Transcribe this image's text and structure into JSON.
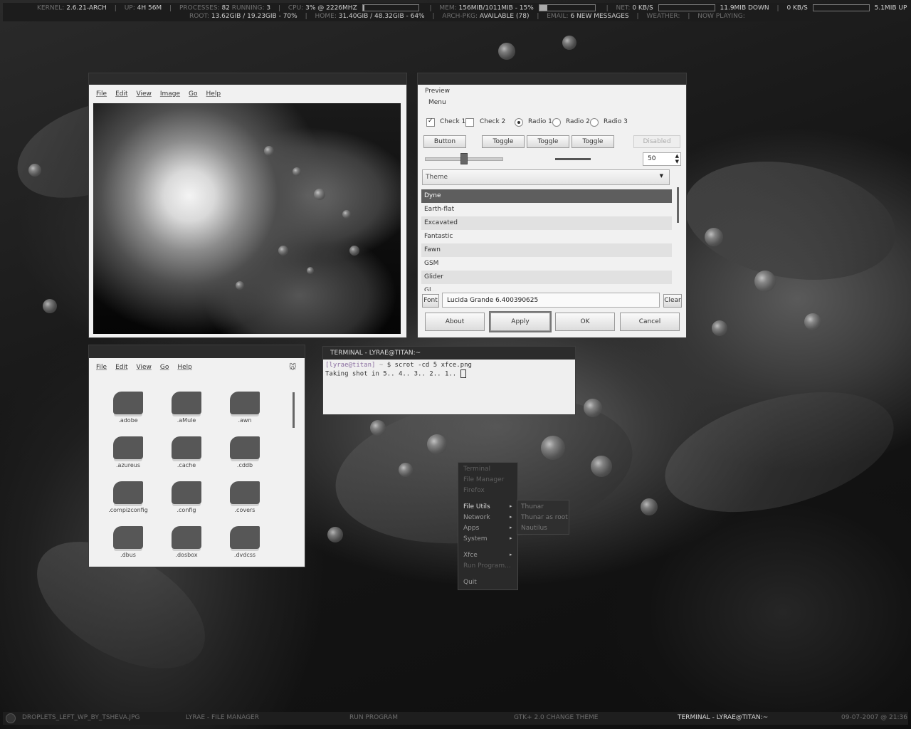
{
  "topbar": {
    "kernel_label": "KERNEL:",
    "kernel": "2.6.21-ARCH",
    "up_label": "UP:",
    "uptime": "4H 56M",
    "processes_label": "PROCESSES:",
    "processes": "82",
    "running_label": "RUNNING:",
    "running": "3",
    "cpu_label": "CPU:",
    "cpu": "3%",
    "cpu_freq": "@ 2226MHZ",
    "cpu_fraction": 0.03,
    "mem_label": "MEM:",
    "mem": "156MIB/1011MIB - 15%",
    "mem_fraction": 0.15,
    "net_label": "NET:",
    "net_down_rate": "0 KB/S",
    "down_total": "11.9MIB DOWN",
    "net_up_rate": "0 KB/S",
    "up_total": "5.1MIB UP",
    "root_label": "ROOT:",
    "root": "13.62GIB / 19.23GIB - 70%",
    "home_label": "HOME:",
    "home": "31.40GIB / 48.32GIB - 64%",
    "archpkg_label": "ARCH-PKG:",
    "archpkg": "AVAILABLE (78)",
    "email_label": "EMAIL:",
    "email": "6 NEW MESSAGES",
    "weather_label": "WEATHER:",
    "nowplaying_label": "NOW PLAYING:"
  },
  "viewer": {
    "menu": [
      "File",
      "Edit",
      "View",
      "Image",
      "Go",
      "Help"
    ]
  },
  "gtk": {
    "preview_label": "Preview",
    "menu_label": "Menu",
    "check1": "Check 1",
    "check2": "Check 2",
    "radio1": "Radio 1",
    "radio2": "Radio 2",
    "radio3": "Radio 3",
    "button": "Button",
    "toggle": "Toggle",
    "disabled": "Disabled",
    "spin_value": "50",
    "slider_level": 0.5,
    "combo_value": "Theme",
    "themes": [
      "Dyne",
      "Earth-flat",
      "Excavated",
      "Fantastic",
      "Fawn",
      "GSM",
      "Glider",
      "Gl..."
    ],
    "font_button": "Font",
    "font_value": "Lucida Grande 6.400390625",
    "clear_button": "Clear",
    "about": "About",
    "apply": "Apply",
    "ok": "OK",
    "cancel": "Cancel"
  },
  "fm": {
    "menu": [
      "File",
      "Edit",
      "View",
      "Go",
      "Help"
    ],
    "folders": [
      ".adobe",
      ".aMule",
      ".awn",
      ".azureus",
      ".cache",
      ".cddb",
      ".compizconfig",
      ".config",
      ".covers",
      ".dbus",
      ".dosbox",
      ".dvdcss"
    ]
  },
  "terminal": {
    "title": "TERMINAL - LYRAE@TITAN:~",
    "prompt": "[lyrae@titan]",
    "prompt_dir": "~",
    "command": "$ scrot -cd 5 xfce.png",
    "output": "Taking shot in 5.. 4.. 3.. 2.. 1.."
  },
  "menu": {
    "items": [
      "Terminal",
      "File Manager",
      "Firefox",
      "File Utils",
      "Network",
      "Apps",
      "System",
      "Xfce",
      "Run Program...",
      "Quit"
    ],
    "submenu": [
      "Thunar",
      "Thunar as root",
      "Nautilus"
    ]
  },
  "bottombar": {
    "items": [
      "DROPLETS_LEFT_WP_BY_TSHEVA.JPG",
      "LYRAE - FILE MANAGER",
      "RUN PROGRAM",
      "GTK+ 2.0 CHANGE THEME",
      "TERMINAL - LYRAE@TITAN:~"
    ],
    "clock": "09-07-2007 @ 21:36"
  }
}
